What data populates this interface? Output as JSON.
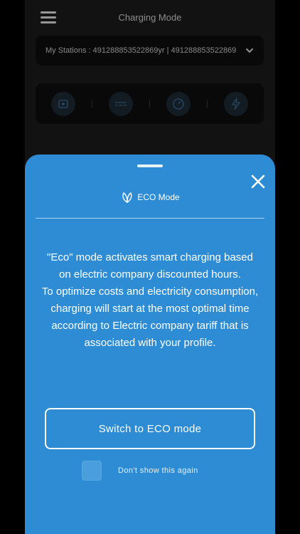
{
  "header": {
    "title": "Charging Mode",
    "menu_icon": "hamburger-menu-icon"
  },
  "station_selector": {
    "value": "My Stations : 491288853522869yr | 491288853522869",
    "icon": "chevron-down-icon"
  },
  "mode_buttons": [
    {
      "icon": "plug-icon"
    },
    {
      "icon": "rate-icon"
    },
    {
      "icon": "gauge-icon"
    },
    {
      "icon": "lightning-icon"
    }
  ],
  "modal": {
    "title": "ECO Mode",
    "icon": "leaf-icon",
    "close_icon": "close-icon",
    "paragraph1": "\"Eco\" mode activates smart charging based on electric company discounted hours.",
    "paragraph2": "To optimize costs and electricity consumption, charging will start at the most optimal time according to Electric company tariff that is associated with your profile.",
    "primary_button": "Switch to ECO mode",
    "checkbox_label": "Don't show this again",
    "checkbox_checked": false
  },
  "colors": {
    "sheet_bg": "#2e8cd4",
    "app_bg": "#1c1c1e",
    "card_bg": "#0e0e10"
  }
}
